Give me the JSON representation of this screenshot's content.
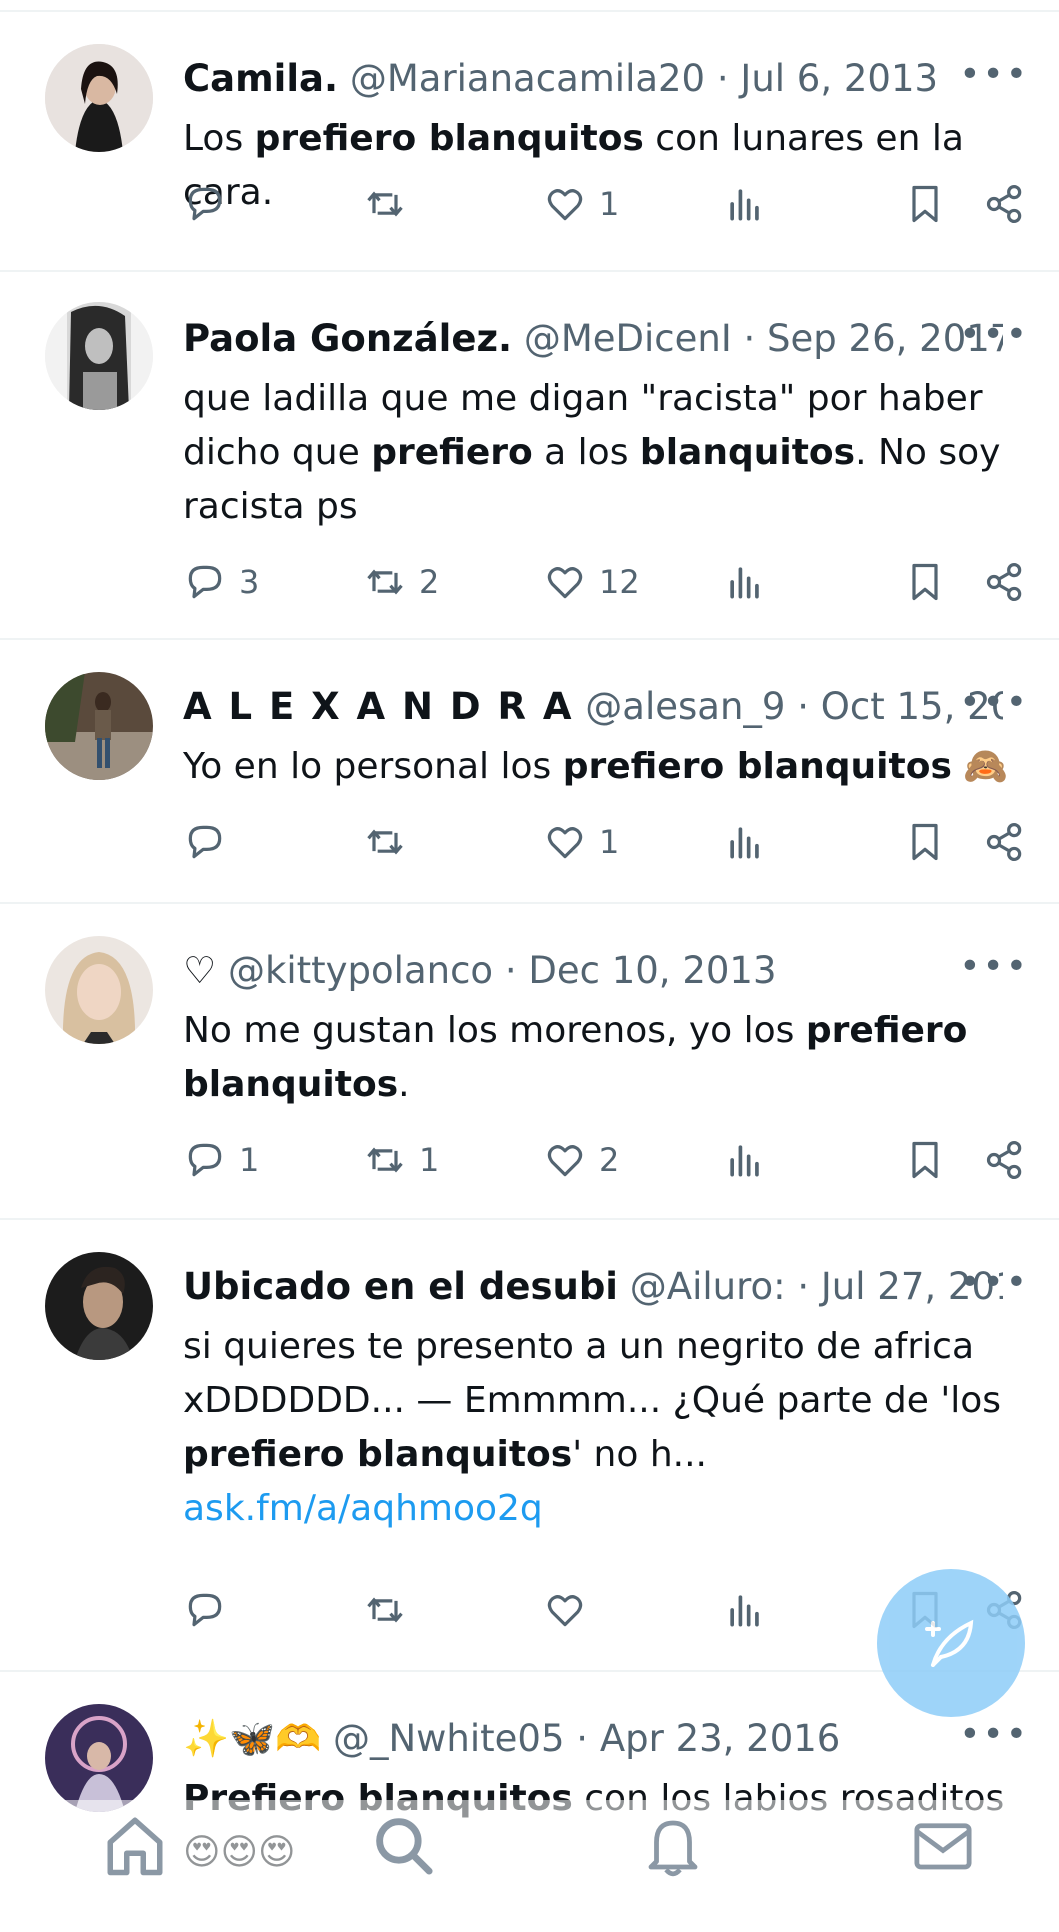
{
  "tweets": [
    {
      "name": "Camila.",
      "handle": "@Marianacamila20",
      "date": "Jul 6, 2013",
      "text_parts": [
        {
          "t": "Los ",
          "b": false
        },
        {
          "t": "prefiero blanquitos",
          "b": true
        },
        {
          "t": " con lunares en la cara.",
          "b": false
        }
      ],
      "reply_count": "",
      "retweet_count": "",
      "like_count": "1"
    },
    {
      "name": "Paola González.",
      "handle": "@MeDicenI",
      "date": "Sep 26, 2017",
      "text_parts": [
        {
          "t": "que ladilla que me digan \"racista\" por haber dicho que ",
          "b": false
        },
        {
          "t": "prefiero",
          "b": true
        },
        {
          "t": " a los ",
          "b": false
        },
        {
          "t": "blanquitos",
          "b": true
        },
        {
          "t": ". No soy racista ps",
          "b": false
        }
      ],
      "reply_count": "3",
      "retweet_count": "2",
      "like_count": "12"
    },
    {
      "name": "A L E X A N D R A",
      "handle": "@alesan_9",
      "date": "Oct 15, 2014",
      "text_parts": [
        {
          "t": "Yo en lo personal los ",
          "b": false
        },
        {
          "t": "prefiero blanquitos",
          "b": true
        },
        {
          "t": " 🙈",
          "b": false
        }
      ],
      "reply_count": "",
      "retweet_count": "",
      "like_count": "1"
    },
    {
      "name": "♡",
      "handle": "@kittypolanco",
      "date": "Dec 10, 2013",
      "text_parts": [
        {
          "t": "No me gustan los morenos, yo los ",
          "b": false
        },
        {
          "t": "prefiero blanquitos",
          "b": true
        },
        {
          "t": ".",
          "b": false
        }
      ],
      "reply_count": "1",
      "retweet_count": "1",
      "like_count": "2"
    },
    {
      "name": "Ubicado en el desubi",
      "handle": "@Ailuro:",
      "date": "Jul 27, 2014",
      "text_parts": [
        {
          "t": "si quieres te presento a un negrito de africa xDDDDDD... — Emmmm... ¿Qué parte de 'los ",
          "b": false
        },
        {
          "t": "prefiero blanquitos",
          "b": true
        },
        {
          "t": "' no h... ",
          "b": false
        }
      ],
      "link": "ask.fm/a/aqhmoo2q",
      "reply_count": "",
      "retweet_count": "",
      "like_count": ""
    },
    {
      "name": "✨🦋🫶",
      "handle": "@_Nwhite05",
      "date": "Apr 23, 2016",
      "text_parts": [
        {
          "t": "Prefiero blanquitos",
          "b": true
        },
        {
          "t": " con los labios rosaditos 😍😍😍",
          "b": false
        }
      ],
      "reply_count": "",
      "retweet_count": "",
      "like_count": ""
    }
  ],
  "separator": "·",
  "more_label": "•••",
  "colors": {
    "accent": "#1d9bf0",
    "muted": "#536471",
    "text": "#0f1419",
    "fab": "#8ecdf8"
  }
}
